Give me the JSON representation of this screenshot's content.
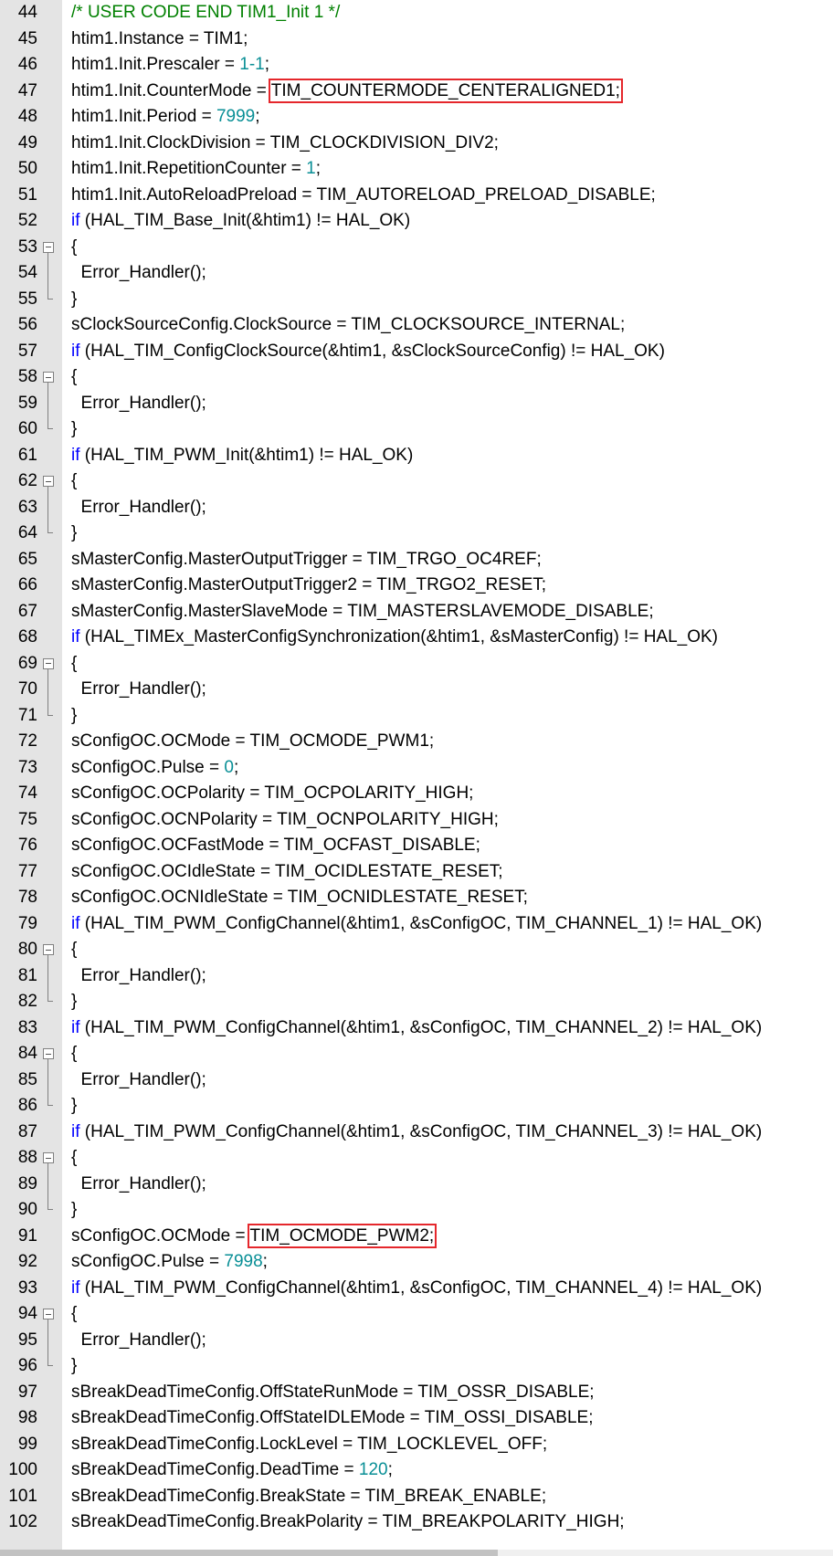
{
  "editor": {
    "lines": [
      {
        "n": "44",
        "fold": "none",
        "t": [
          {
            "s": "/* USER CODE END TIM1_Init 1 */",
            "c": "cm"
          }
        ]
      },
      {
        "n": "45",
        "fold": "none",
        "t": [
          {
            "s": "htim1.Instance = TIM1;"
          }
        ]
      },
      {
        "n": "46",
        "fold": "none",
        "t": [
          {
            "s": "htim1.Init.Prescaler = "
          },
          {
            "s": "1-1",
            "c": "num"
          },
          {
            "s": ";"
          }
        ]
      },
      {
        "n": "47",
        "fold": "none",
        "t": [
          {
            "s": "htim1.Init.CounterMode = "
          },
          {
            "s": "TIM_COUNTERMODE_CENTERALIGNED1;",
            "hl": true,
            "name": "highlight-counter-mode"
          }
        ]
      },
      {
        "n": "48",
        "fold": "none",
        "t": [
          {
            "s": "htim1.Init.Period = "
          },
          {
            "s": "7999",
            "c": "num"
          },
          {
            "s": ";"
          }
        ]
      },
      {
        "n": "49",
        "fold": "none",
        "t": [
          {
            "s": "htim1.Init.ClockDivision = TIM_CLOCKDIVISION_DIV2;"
          }
        ]
      },
      {
        "n": "50",
        "fold": "none",
        "t": [
          {
            "s": "htim1.Init.RepetitionCounter = "
          },
          {
            "s": "1",
            "c": "num"
          },
          {
            "s": ";"
          }
        ]
      },
      {
        "n": "51",
        "fold": "none",
        "t": [
          {
            "s": "htim1.Init.AutoReloadPreload = TIM_AUTORELOAD_PRELOAD_DISABLE;"
          }
        ]
      },
      {
        "n": "52",
        "fold": "none",
        "t": [
          {
            "s": "if",
            "c": "kw"
          },
          {
            "s": " (HAL_TIM_Base_Init(&htim1) != HAL_OK)"
          }
        ]
      },
      {
        "n": "53",
        "fold": "start",
        "t": [
          {
            "s": "{"
          }
        ]
      },
      {
        "n": "54",
        "fold": "mid",
        "t": [
          {
            "s": "  Error_Handler();"
          }
        ]
      },
      {
        "n": "55",
        "fold": "end",
        "t": [
          {
            "s": "}"
          }
        ]
      },
      {
        "n": "56",
        "fold": "none",
        "t": [
          {
            "s": "sClockSourceConfig.ClockSource = TIM_CLOCKSOURCE_INTERNAL;"
          }
        ]
      },
      {
        "n": "57",
        "fold": "none",
        "t": [
          {
            "s": "if",
            "c": "kw"
          },
          {
            "s": " (HAL_TIM_ConfigClockSource(&htim1, &sClockSourceConfig) != HAL_OK)"
          }
        ]
      },
      {
        "n": "58",
        "fold": "start",
        "t": [
          {
            "s": "{"
          }
        ]
      },
      {
        "n": "59",
        "fold": "mid",
        "t": [
          {
            "s": "  Error_Handler();"
          }
        ]
      },
      {
        "n": "60",
        "fold": "end",
        "t": [
          {
            "s": "}"
          }
        ]
      },
      {
        "n": "61",
        "fold": "none",
        "t": [
          {
            "s": "if",
            "c": "kw"
          },
          {
            "s": " (HAL_TIM_PWM_Init(&htim1) != HAL_OK)"
          }
        ]
      },
      {
        "n": "62",
        "fold": "start",
        "t": [
          {
            "s": "{"
          }
        ]
      },
      {
        "n": "63",
        "fold": "mid",
        "t": [
          {
            "s": "  Error_Handler();"
          }
        ]
      },
      {
        "n": "64",
        "fold": "end",
        "t": [
          {
            "s": "}"
          }
        ]
      },
      {
        "n": "65",
        "fold": "none",
        "t": [
          {
            "s": "sMasterConfig.MasterOutputTrigger = TIM_TRGO_OC4REF;"
          }
        ]
      },
      {
        "n": "66",
        "fold": "none",
        "t": [
          {
            "s": "sMasterConfig.MasterOutputTrigger2 = TIM_TRGO2_RESET;"
          }
        ]
      },
      {
        "n": "67",
        "fold": "none",
        "t": [
          {
            "s": "sMasterConfig.MasterSlaveMode = TIM_MASTERSLAVEMODE_DISABLE;"
          }
        ]
      },
      {
        "n": "68",
        "fold": "none",
        "t": [
          {
            "s": "if",
            "c": "kw"
          },
          {
            "s": " (HAL_TIMEx_MasterConfigSynchronization(&htim1, &sMasterConfig) != HAL_OK)"
          }
        ]
      },
      {
        "n": "69",
        "fold": "start",
        "t": [
          {
            "s": "{"
          }
        ]
      },
      {
        "n": "70",
        "fold": "mid",
        "t": [
          {
            "s": "  Error_Handler();"
          }
        ]
      },
      {
        "n": "71",
        "fold": "end",
        "t": [
          {
            "s": "}"
          }
        ]
      },
      {
        "n": "72",
        "fold": "none",
        "t": [
          {
            "s": "sConfigOC.OCMode = TIM_OCMODE_PWM1;"
          }
        ]
      },
      {
        "n": "73",
        "fold": "none",
        "t": [
          {
            "s": "sConfigOC.Pulse = "
          },
          {
            "s": "0",
            "c": "num"
          },
          {
            "s": ";"
          }
        ]
      },
      {
        "n": "74",
        "fold": "none",
        "t": [
          {
            "s": "sConfigOC.OCPolarity = TIM_OCPOLARITY_HIGH;"
          }
        ]
      },
      {
        "n": "75",
        "fold": "none",
        "t": [
          {
            "s": "sConfigOC.OCNPolarity = TIM_OCNPOLARITY_HIGH;"
          }
        ]
      },
      {
        "n": "76",
        "fold": "none",
        "t": [
          {
            "s": "sConfigOC.OCFastMode = TIM_OCFAST_DISABLE;"
          }
        ]
      },
      {
        "n": "77",
        "fold": "none",
        "t": [
          {
            "s": "sConfigOC.OCIdleState = TIM_OCIDLESTATE_RESET;"
          }
        ]
      },
      {
        "n": "78",
        "fold": "none",
        "t": [
          {
            "s": "sConfigOC.OCNIdleState = TIM_OCNIDLESTATE_RESET;"
          }
        ]
      },
      {
        "n": "79",
        "fold": "none",
        "t": [
          {
            "s": "if",
            "c": "kw"
          },
          {
            "s": " (HAL_TIM_PWM_ConfigChannel(&htim1, &sConfigOC, TIM_CHANNEL_1) != HAL_OK)"
          }
        ]
      },
      {
        "n": "80",
        "fold": "start",
        "t": [
          {
            "s": "{"
          }
        ]
      },
      {
        "n": "81",
        "fold": "mid",
        "t": [
          {
            "s": "  Error_Handler();"
          }
        ]
      },
      {
        "n": "82",
        "fold": "end",
        "t": [
          {
            "s": "}"
          }
        ]
      },
      {
        "n": "83",
        "fold": "none",
        "t": [
          {
            "s": "if",
            "c": "kw"
          },
          {
            "s": " (HAL_TIM_PWM_ConfigChannel(&htim1, &sConfigOC, TIM_CHANNEL_2) != HAL_OK)"
          }
        ]
      },
      {
        "n": "84",
        "fold": "start",
        "t": [
          {
            "s": "{"
          }
        ]
      },
      {
        "n": "85",
        "fold": "mid",
        "t": [
          {
            "s": "  Error_Handler();"
          }
        ]
      },
      {
        "n": "86",
        "fold": "end",
        "t": [
          {
            "s": "}"
          }
        ]
      },
      {
        "n": "87",
        "fold": "none",
        "t": [
          {
            "s": "if",
            "c": "kw"
          },
          {
            "s": " (HAL_TIM_PWM_ConfigChannel(&htim1, &sConfigOC, TIM_CHANNEL_3) != HAL_OK)"
          }
        ]
      },
      {
        "n": "88",
        "fold": "start",
        "t": [
          {
            "s": "{"
          }
        ]
      },
      {
        "n": "89",
        "fold": "mid",
        "t": [
          {
            "s": "  Error_Handler();"
          }
        ]
      },
      {
        "n": "90",
        "fold": "end",
        "t": [
          {
            "s": "}"
          }
        ]
      },
      {
        "n": "91",
        "fold": "none",
        "t": [
          {
            "s": "sConfigOC.OCMode = "
          },
          {
            "s": "TIM_OCMODE_PWM2;",
            "hl": true,
            "name": "highlight-oc-mode"
          }
        ]
      },
      {
        "n": "92",
        "fold": "none",
        "t": [
          {
            "s": "sConfigOC.Pulse = "
          },
          {
            "s": "7998",
            "c": "num"
          },
          {
            "s": ";"
          }
        ]
      },
      {
        "n": "93",
        "fold": "none",
        "t": [
          {
            "s": "if",
            "c": "kw"
          },
          {
            "s": " (HAL_TIM_PWM_ConfigChannel(&htim1, &sConfigOC, TIM_CHANNEL_4) != HAL_OK)"
          }
        ]
      },
      {
        "n": "94",
        "fold": "start",
        "t": [
          {
            "s": "{"
          }
        ]
      },
      {
        "n": "95",
        "fold": "mid",
        "t": [
          {
            "s": "  Error_Handler();"
          }
        ]
      },
      {
        "n": "96",
        "fold": "end",
        "t": [
          {
            "s": "}"
          }
        ]
      },
      {
        "n": "97",
        "fold": "none",
        "t": [
          {
            "s": "sBreakDeadTimeConfig.OffStateRunMode = TIM_OSSR_DISABLE;"
          }
        ]
      },
      {
        "n": "98",
        "fold": "none",
        "t": [
          {
            "s": "sBreakDeadTimeConfig.OffStateIDLEMode = TIM_OSSI_DISABLE;"
          }
        ]
      },
      {
        "n": "99",
        "fold": "none",
        "t": [
          {
            "s": "sBreakDeadTimeConfig.LockLevel = TIM_LOCKLEVEL_OFF;"
          }
        ]
      },
      {
        "n": "100",
        "fold": "none",
        "t": [
          {
            "s": "sBreakDeadTimeConfig.DeadTime = "
          },
          {
            "s": "120",
            "c": "num"
          },
          {
            "s": ";"
          }
        ]
      },
      {
        "n": "101",
        "fold": "none",
        "t": [
          {
            "s": "sBreakDeadTimeConfig.BreakState = TIM_BREAK_ENABLE;"
          }
        ]
      },
      {
        "n": "102",
        "fold": "none",
        "t": [
          {
            "s": "sBreakDeadTimeConfig.BreakPolarity = TIM_BREAKPOLARITY_HIGH;"
          }
        ]
      }
    ]
  },
  "colors": {
    "keyword": "#0000ff",
    "number": "#098f96",
    "comment": "#008000",
    "highlight_box": "#e5272c",
    "gutter": "#e4e4e4"
  },
  "icons": {
    "fold_start": "fold-collapse-icon",
    "fold_line": "fold-guide-line",
    "fold_end": "fold-end-marker"
  }
}
